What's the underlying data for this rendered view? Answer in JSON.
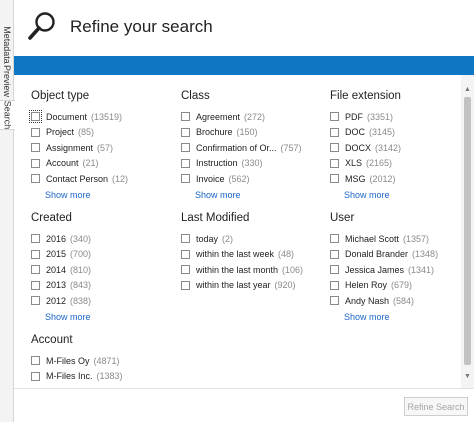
{
  "side_tabs": [
    "Metadata",
    "Preview",
    "Search"
  ],
  "header": {
    "title": "Refine your search"
  },
  "facet_rows": [
    [
      {
        "title": "Object type",
        "items": [
          {
            "label": "Document",
            "count": "(13519)"
          },
          {
            "label": "Project",
            "count": "(85)"
          },
          {
            "label": "Assignment",
            "count": "(57)"
          },
          {
            "label": "Account",
            "count": "(21)"
          },
          {
            "label": "Contact Person",
            "count": "(12)"
          }
        ],
        "show_more": "Show more"
      },
      {
        "title": "Class",
        "items": [
          {
            "label": "Agreement",
            "count": "(272)"
          },
          {
            "label": "Brochure",
            "count": "(150)"
          },
          {
            "label": "Confirmation of Or...",
            "count": "(757)"
          },
          {
            "label": "Instruction",
            "count": "(330)"
          },
          {
            "label": "Invoice",
            "count": "(562)"
          }
        ],
        "show_more": "Show more"
      },
      {
        "title": "File extension",
        "items": [
          {
            "label": "PDF",
            "count": "(3351)"
          },
          {
            "label": "DOC",
            "count": "(3145)"
          },
          {
            "label": "DOCX",
            "count": "(3142)"
          },
          {
            "label": "XLS",
            "count": "(2165)"
          },
          {
            "label": "MSG",
            "count": "(2012)"
          }
        ],
        "show_more": "Show more"
      }
    ],
    [
      {
        "title": "Created",
        "items": [
          {
            "label": "2016",
            "count": "(340)"
          },
          {
            "label": "2015",
            "count": "(700)"
          },
          {
            "label": "2014",
            "count": "(810)"
          },
          {
            "label": "2013",
            "count": "(843)"
          },
          {
            "label": "2012",
            "count": "(838)"
          }
        ],
        "show_more": "Show more"
      },
      {
        "title": "Last Modified",
        "items": [
          {
            "label": "today",
            "count": "(2)"
          },
          {
            "label": "within the last week",
            "count": "(48)"
          },
          {
            "label": "within the last month",
            "count": "(106)"
          },
          {
            "label": "within the last year",
            "count": "(920)"
          }
        ],
        "show_more": ""
      },
      {
        "title": "User",
        "items": [
          {
            "label": "Michael Scott",
            "count": "(1357)"
          },
          {
            "label": "Donald Brander",
            "count": "(1348)"
          },
          {
            "label": "Jessica James",
            "count": "(1341)"
          },
          {
            "label": "Helen Roy",
            "count": "(679)"
          },
          {
            "label": "Andy Nash",
            "count": "(584)"
          }
        ],
        "show_more": "Show more"
      }
    ],
    [
      {
        "title": "Account",
        "items": [
          {
            "label": "M-Files Oy",
            "count": "(4871)"
          },
          {
            "label": "M-Files Inc.",
            "count": "(1383)"
          }
        ],
        "show_more": ""
      }
    ]
  ],
  "footer": {
    "refine_button": "Refine Search"
  },
  "colors": {
    "accent_bar": "#0f75c5",
    "link": "#1a66c9",
    "count_text": "#8a8a8a"
  }
}
